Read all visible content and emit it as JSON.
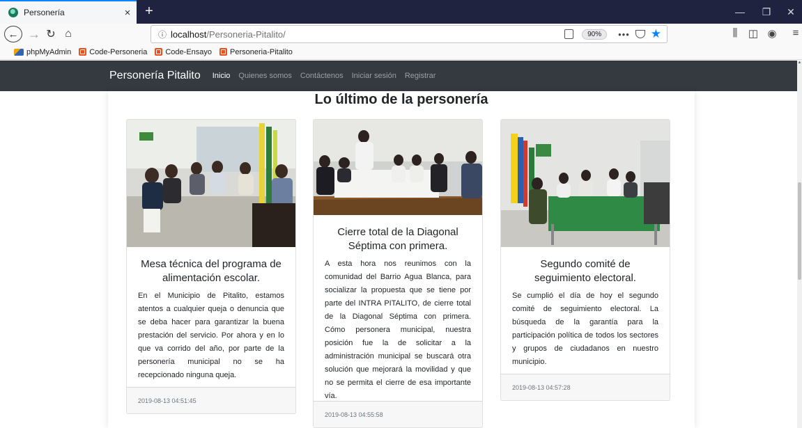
{
  "browser": {
    "tab_title": "Personería",
    "tab_close": "×",
    "new_tab": "+",
    "url_host": "localhost",
    "url_path": "/Personeria-Pitalito/",
    "zoom": "90%",
    "bookmarks": [
      "phpMyAdmin",
      "Code-Personeria",
      "Code-Ensayo",
      "Personeria-Pitalito"
    ]
  },
  "site": {
    "brand": "Personería Pitalito",
    "nav": [
      "Inicio",
      "Quienes somos",
      "Contáctenos",
      "Iniciar sesión",
      "Registrar"
    ],
    "section_title": "Lo último de la personería"
  },
  "cards": [
    {
      "title": "Mesa técnica del programa de alimentación escolar.",
      "text": "En el Municipio de Pitalito, estamos atentos a cualquier queja o denuncia que se deba hacer para garantizar la buena prestación del servicio. Por ahora y en lo que va corrido del año, por parte de la personería municipal no se ha recepcionado ninguna queja.",
      "date": "2019-08-13 04:51:45"
    },
    {
      "title": "Cierre total de la Diagonal Séptima con primera.",
      "text": "A esta hora nos reunimos con la comunidad del Barrio Agua Blanca, para socializar la propuesta que se tiene por parte del INTRA PITALITO, de cierre total de la Diagonal Séptima con primera. Cómo personera municipal, nuestra posición fue la de solicitar a la administración municipal se buscará otra solución que mejorará la movilidad y que no se permita el cierre de esa importante vía.",
      "date": "2019-08-13 04:55:58"
    },
    {
      "title": "Segundo comité de seguimiento electoral.",
      "text": "Se cumplió el día de hoy el segundo comité de seguimiento electoral. La búsqueda de la garantía para la participación política de todos los sectores y grupos de ciudadanos en nuestro municipio.",
      "date": "2019-08-13 04:57:28"
    }
  ]
}
